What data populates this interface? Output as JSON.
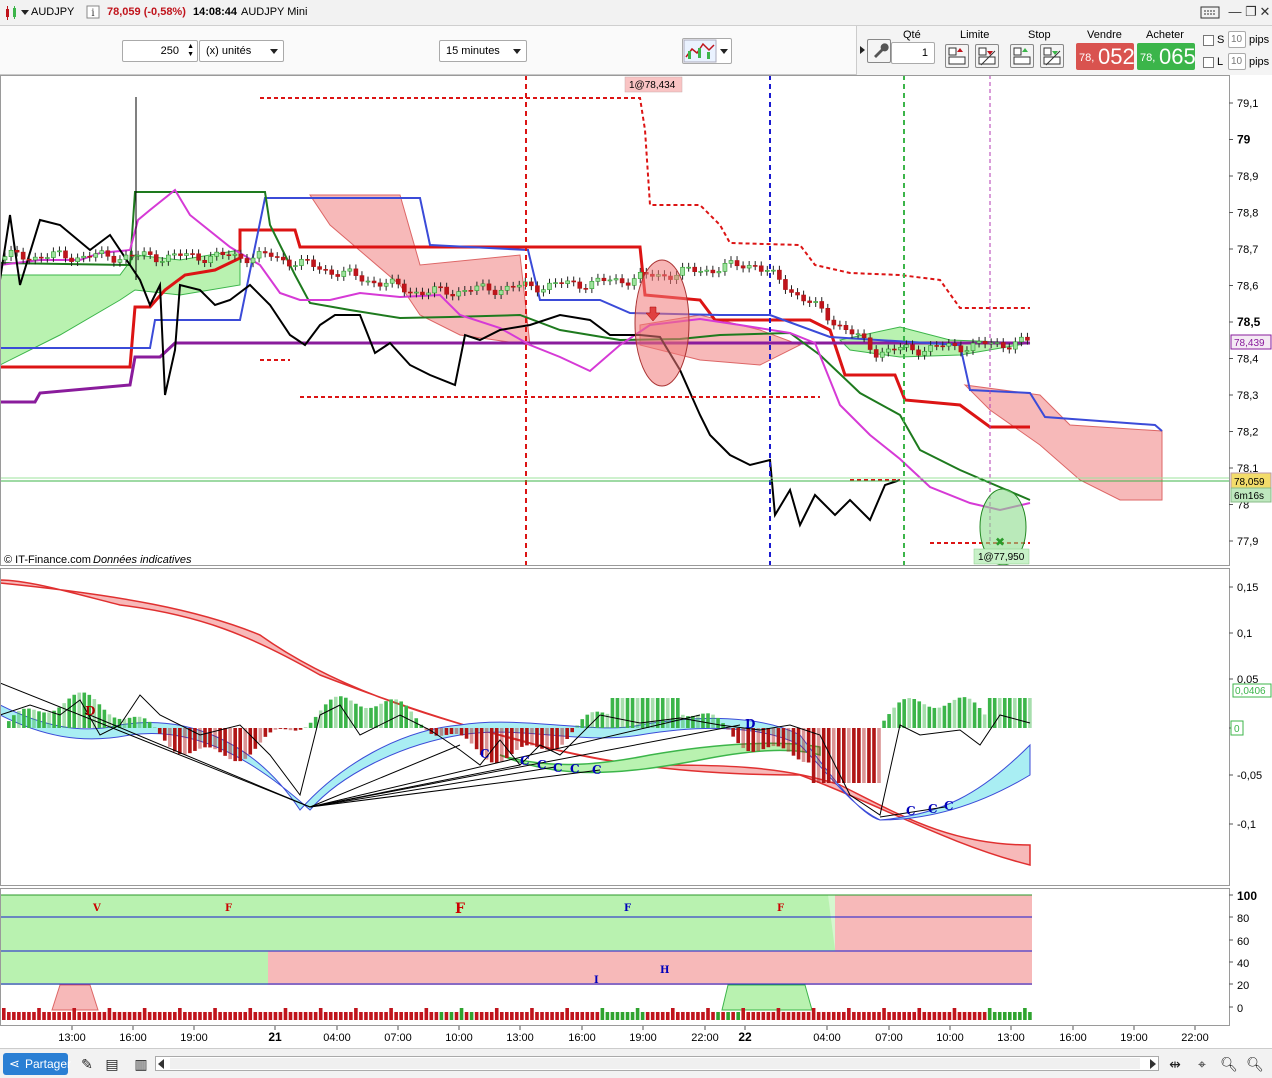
{
  "titlebar": {
    "symbol": "AUDJPY",
    "price_change": "78,059 (-0,58%)",
    "time": "14:08:44",
    "instrument": "AUDJPY Mini"
  },
  "toolbar": {
    "quantity_value": "250",
    "unit_select": "(x) unités",
    "timeframe_select": "15 minutes",
    "qty_label": "Qté",
    "qty_value": "1",
    "limit_label": "Limite",
    "stop_label": "Stop",
    "sell_label": "Vendre",
    "buy_label": "Acheter",
    "sell_price_small": "78,",
    "sell_price_big": "052",
    "buy_price_small": "78,",
    "buy_price_big": "065",
    "s_label": "S",
    "l_label": "L",
    "pips_value_1": "10",
    "pips_value_2": "10",
    "pips_label": "pips"
  },
  "chart": {
    "copyright": "© IT-Finance.com",
    "copyright_note": "Données indicatives",
    "price_axis": [
      "79,1",
      "79",
      "78,9",
      "78,8",
      "78,7",
      "78,6",
      "78,5",
      "78,4",
      "78,3",
      "78,2",
      "78,1",
      "78",
      "77,9"
    ],
    "last_price_tag": "78,059",
    "countdown_tag": "6m16s",
    "level_tag": "78,439",
    "order_label_top": "1@78,434",
    "order_label_bottom": "1@77,950",
    "osc_axis": [
      "0,15",
      "0,1",
      "0,05",
      "0",
      "-0,05",
      "-0,1"
    ],
    "osc_value_tag": "0,0406",
    "osc_zero_tag": "0",
    "pct_axis": [
      "100",
      "80",
      "60",
      "40",
      "20",
      "0"
    ],
    "time_axis": [
      "13:00",
      "16:00",
      "19:00",
      "21",
      "04:00",
      "07:00",
      "10:00",
      "13:00",
      "16:00",
      "19:00",
      "22:00",
      "22",
      "04:00",
      "07:00",
      "10:00",
      "13:00",
      "16:00",
      "19:00",
      "22:00"
    ],
    "marker_letters_osc": [
      "D",
      "C",
      "C",
      "C",
      "C",
      "C",
      "C",
      "D",
      "C",
      "C",
      "C"
    ],
    "marker_letters_pct": [
      "V",
      "F",
      "F",
      "F",
      "F",
      "I",
      "H"
    ]
  },
  "bottombar": {
    "share_label": "Partager"
  },
  "colors": {
    "bull": "#3cb54a",
    "bear": "#c0141c",
    "cloud_green": "#b9f2b0",
    "cloud_red": "#f7b9b9",
    "purple": "#8a1c9c",
    "blue": "#3b4bd8",
    "accent_sell": "#d9534f",
    "accent_buy": "#3bb54a"
  }
}
